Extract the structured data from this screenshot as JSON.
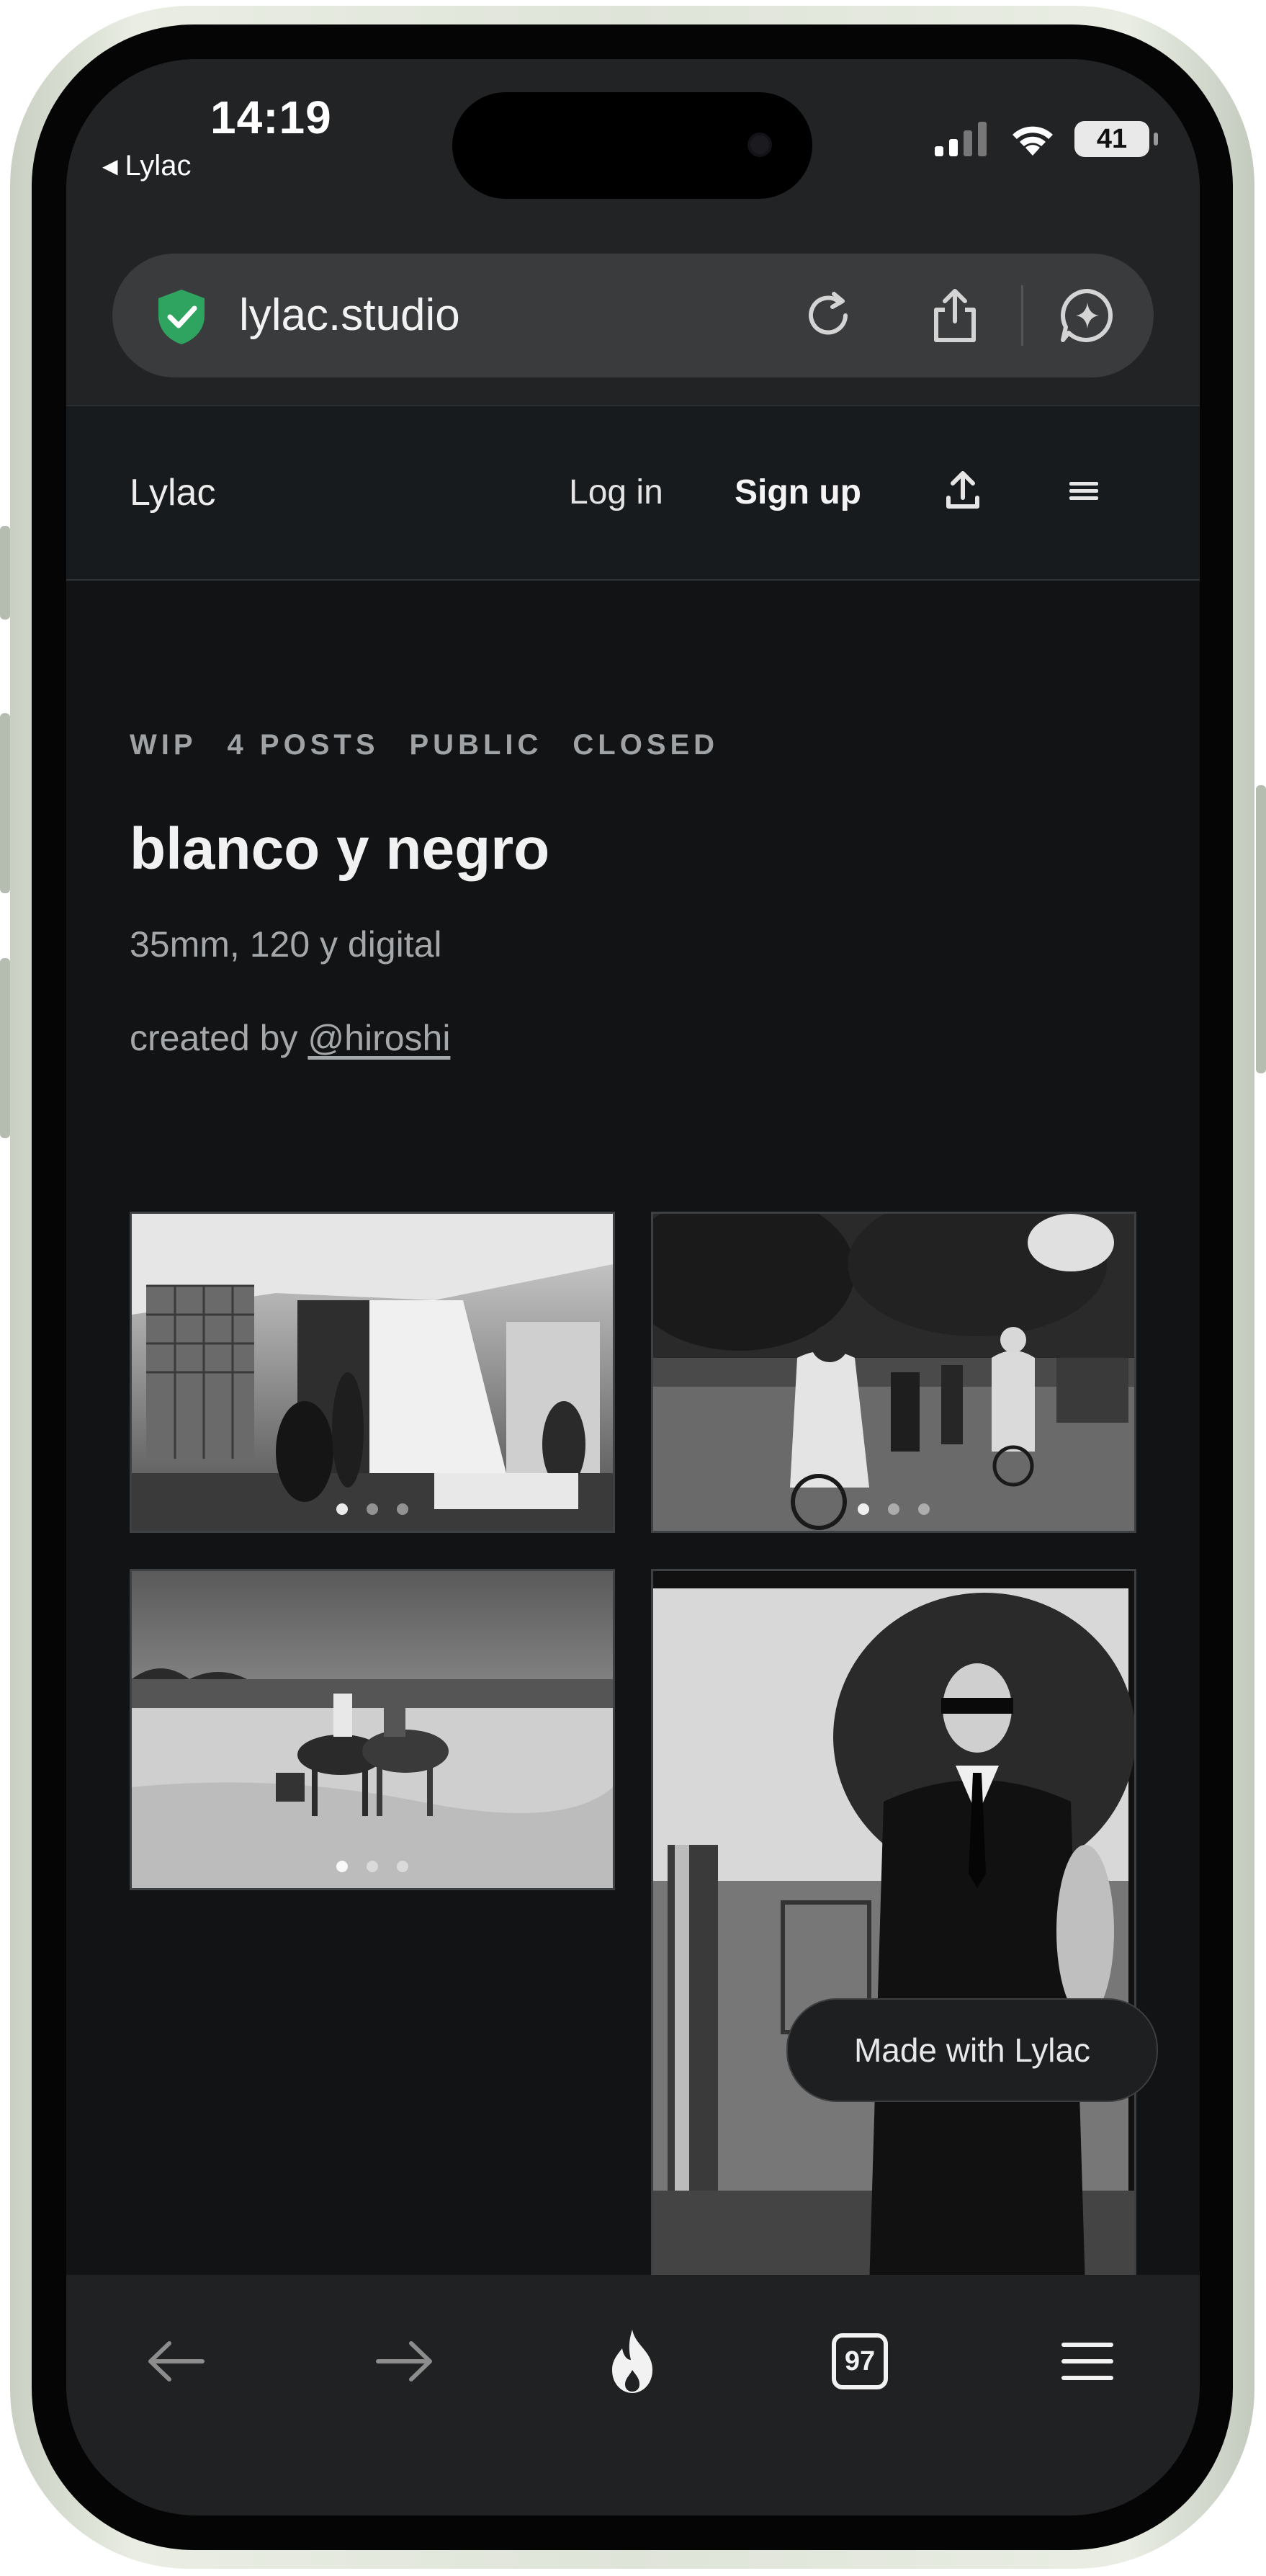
{
  "status_bar": {
    "time": "14:19",
    "back_app": "Lylac",
    "battery": "41"
  },
  "browser": {
    "url": "lylac.studio",
    "tab_count": "97"
  },
  "site_header": {
    "logo": "Lylac",
    "login": "Log in",
    "signup": "Sign up"
  },
  "collection": {
    "tags": [
      "WIP",
      "4 POSTS",
      "PUBLIC",
      "CLOSED"
    ],
    "title": "blanco y negro",
    "subtitle": "35mm, 120 y digital",
    "created_by_prefix": "created by",
    "author": "@hiroshi"
  },
  "badge": {
    "label": "Made with Lylac"
  },
  "icons": {
    "secure": "shield-check-icon",
    "reload": "reload-icon",
    "share": "share-icon",
    "assistant": "sparkle-chat-icon",
    "upload": "upload-icon",
    "menu": "hamburger-icon",
    "back": "arrow-left-icon",
    "forward": "arrow-right-icon",
    "home": "flame-icon",
    "tabs": "tabs-icon",
    "browser_menu": "hamburger-icon"
  },
  "colors": {
    "background": "#111315",
    "accent_shield": "#2fa360",
    "text_primary": "#f1f1f1",
    "text_secondary": "#a5a8aa"
  }
}
